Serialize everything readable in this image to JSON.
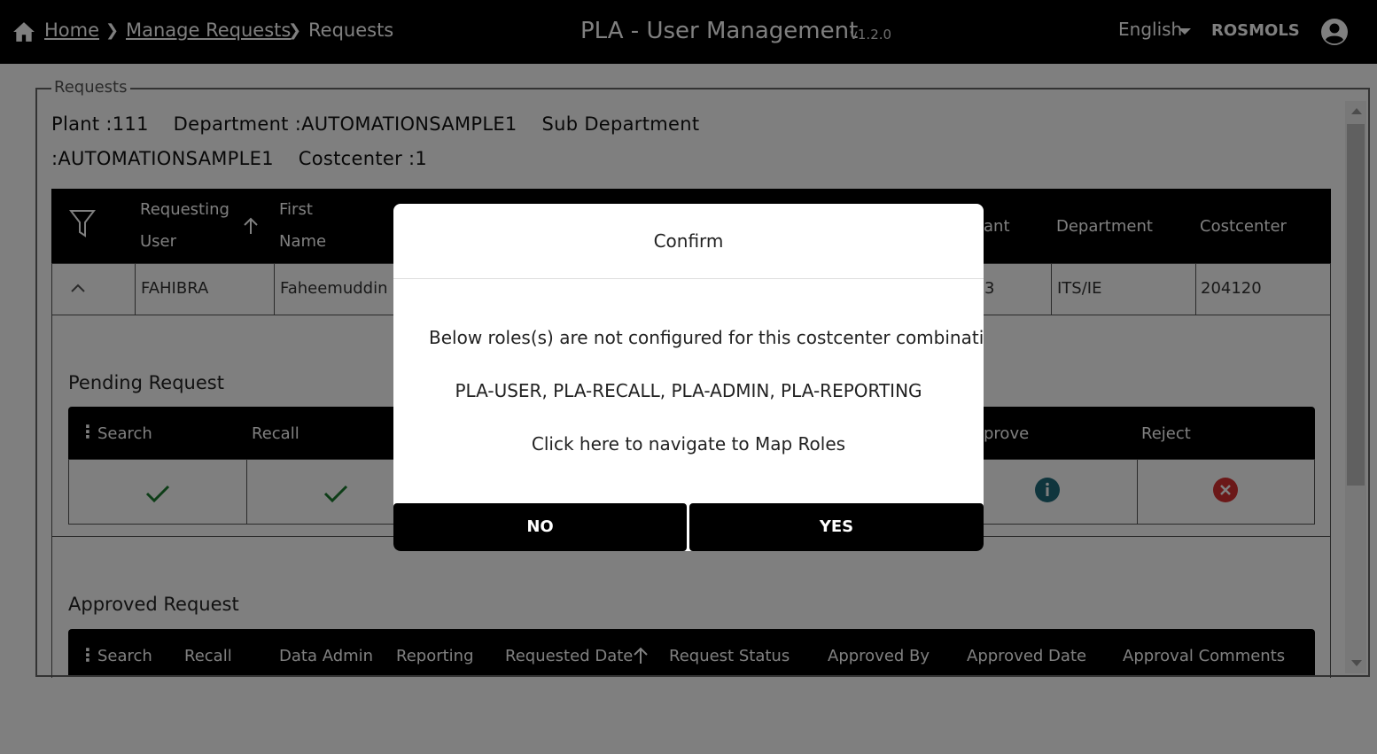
{
  "header": {
    "breadcrumbs": [
      "Home",
      "Manage Requests",
      "Requests"
    ],
    "app_title": "PLA - User Management",
    "version": "v1.2.0",
    "language": "English",
    "username": "ROSMOLS"
  },
  "page": {
    "legend": "Requests",
    "info_line1": "Plant :111    Department :AUTOMATIONSAMPLE1    Sub Department",
    "info_line2": ":AUTOMATIONSAMPLE1    Costcenter :1"
  },
  "table": {
    "headers": {
      "requesting_user_1": "Requesting",
      "requesting_user_2": "User",
      "first_name_1": "First",
      "first_name_2": "Name",
      "plant_partial": "ant",
      "department": "Department",
      "costcenter": "Costcenter"
    },
    "row": {
      "requesting_user": "FAHIBRA",
      "first_name": "Faheemuddin",
      "plant_partial": "3",
      "department": "ITS/IE",
      "costcenter": "204120"
    }
  },
  "pending": {
    "title": "Pending Request",
    "headers": {
      "search": "Search",
      "recall": "Recall",
      "approve_partial": "prove",
      "reject": "Reject"
    }
  },
  "approved": {
    "title": "Approved Request",
    "headers": {
      "search": "Search",
      "recall": "Recall",
      "data_admin": "Data Admin",
      "reporting": "Reporting",
      "requested_date": "Requested Date",
      "request_status": "Request Status",
      "approved_by": "Approved By",
      "approved_date": "Approved Date",
      "approval_comments": "Approval Comments"
    }
  },
  "dialog": {
    "title": "Confirm",
    "message1": "Below roles(s) are not configured for this costcenter combination",
    "message2": "PLA-USER, PLA-RECALL, PLA-ADMIN, PLA-REPORTING",
    "message3": "Click here to navigate to Map Roles",
    "no_label": "NO",
    "yes_label": "YES"
  },
  "colors": {
    "check": "#1a7a2e",
    "info": "#1e6a7a",
    "reject": "#d63030"
  }
}
